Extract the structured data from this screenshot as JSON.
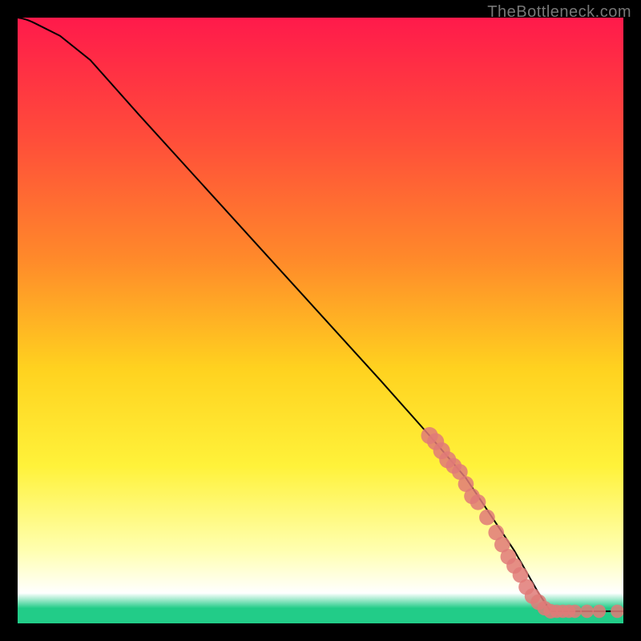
{
  "watermark": "TheBottleneck.com",
  "chart_data": {
    "type": "line",
    "title": "",
    "xlabel": "",
    "ylabel": "",
    "xlim": [
      0,
      100
    ],
    "ylim": [
      0,
      100
    ],
    "grid": false,
    "legend": null,
    "gradient_stops": [
      {
        "offset": 0.0,
        "color": "#ff1a4b"
      },
      {
        "offset": 0.2,
        "color": "#ff4d3a"
      },
      {
        "offset": 0.4,
        "color": "#ff8a2a"
      },
      {
        "offset": 0.58,
        "color": "#ffd21f"
      },
      {
        "offset": 0.74,
        "color": "#fff23a"
      },
      {
        "offset": 0.88,
        "color": "#ffffb0"
      },
      {
        "offset": 0.95,
        "color": "#ffffff"
      },
      {
        "offset": 0.975,
        "color": "#22cc88"
      },
      {
        "offset": 1.0,
        "color": "#22cc88"
      }
    ],
    "series": [
      {
        "name": "curve",
        "x": [
          0,
          3,
          7,
          12,
          20,
          30,
          40,
          50,
          60,
          68,
          74,
          78,
          82,
          86,
          88,
          100
        ],
        "y": [
          100,
          99,
          97,
          93,
          84,
          73,
          62,
          51,
          40,
          31,
          24,
          18,
          12,
          5,
          2,
          2
        ]
      }
    ],
    "markers": {
      "name": "dots",
      "color": "#e07a78",
      "points": [
        {
          "x": 68,
          "y": 31,
          "r": 1.4
        },
        {
          "x": 69,
          "y": 30,
          "r": 1.4
        },
        {
          "x": 70,
          "y": 28.5,
          "r": 1.4
        },
        {
          "x": 71,
          "y": 27,
          "r": 1.4
        },
        {
          "x": 72,
          "y": 26,
          "r": 1.3
        },
        {
          "x": 73,
          "y": 25,
          "r": 1.3
        },
        {
          "x": 74,
          "y": 23,
          "r": 1.3
        },
        {
          "x": 75,
          "y": 21,
          "r": 1.3
        },
        {
          "x": 76,
          "y": 20,
          "r": 1.3
        },
        {
          "x": 77.5,
          "y": 17.5,
          "r": 1.3
        },
        {
          "x": 79,
          "y": 15,
          "r": 1.3
        },
        {
          "x": 80,
          "y": 13,
          "r": 1.3
        },
        {
          "x": 81,
          "y": 11,
          "r": 1.3
        },
        {
          "x": 82,
          "y": 9.5,
          "r": 1.3
        },
        {
          "x": 83,
          "y": 8,
          "r": 1.3
        },
        {
          "x": 84,
          "y": 6,
          "r": 1.3
        },
        {
          "x": 85,
          "y": 4.5,
          "r": 1.3
        },
        {
          "x": 86,
          "y": 3.5,
          "r": 1.3
        },
        {
          "x": 87,
          "y": 2.5,
          "r": 1.2
        },
        {
          "x": 88,
          "y": 2,
          "r": 1.2
        },
        {
          "x": 89,
          "y": 2,
          "r": 1.1
        },
        {
          "x": 90,
          "y": 2,
          "r": 1.1
        },
        {
          "x": 91,
          "y": 2,
          "r": 1.1
        },
        {
          "x": 92,
          "y": 2,
          "r": 1.1
        },
        {
          "x": 94,
          "y": 2,
          "r": 1.1
        },
        {
          "x": 96,
          "y": 2,
          "r": 1.1
        },
        {
          "x": 99,
          "y": 2,
          "r": 1.1
        }
      ]
    }
  }
}
